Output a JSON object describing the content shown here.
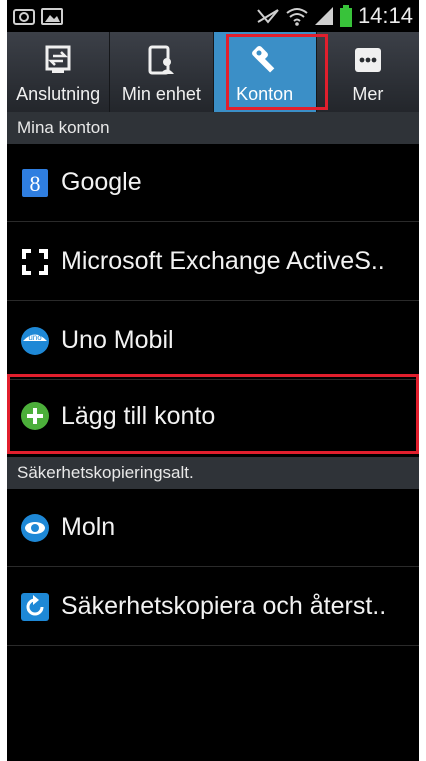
{
  "status_bar": {
    "time": "14:14",
    "left_icons": [
      "camera-icon",
      "image-icon"
    ],
    "right_icons": [
      "no-sim-icon",
      "wifi-icon",
      "signal-icon",
      "battery-icon"
    ]
  },
  "tabs": [
    {
      "label": "Anslutning",
      "icon": "connection-icon",
      "active": false
    },
    {
      "label": "Min enhet",
      "icon": "device-icon",
      "active": false
    },
    {
      "label": "Konton",
      "icon": "key-icon",
      "active": true
    },
    {
      "label": "Mer",
      "icon": "more-icon",
      "active": false
    }
  ],
  "sections": {
    "accounts_header": "Mina konton",
    "backup_header": "Säkerhetskopieringsalt."
  },
  "accounts": [
    {
      "label": "Google",
      "icon": "google-icon"
    },
    {
      "label": "Microsoft Exchange ActiveS..",
      "icon": "exchange-icon"
    },
    {
      "label": "Uno Mobil",
      "icon": "uno-mobil-icon"
    },
    {
      "label": "Lägg till konto",
      "icon": "add-icon"
    }
  ],
  "backup": [
    {
      "label": "Moln",
      "icon": "cloud-icon"
    },
    {
      "label": "Säkerhetskopiera och återst..",
      "icon": "backup-restore-icon"
    }
  ],
  "colors": {
    "active_tab": "#3b8fc7",
    "highlight": "#e11f2d",
    "section_bg": "#2f3338"
  }
}
